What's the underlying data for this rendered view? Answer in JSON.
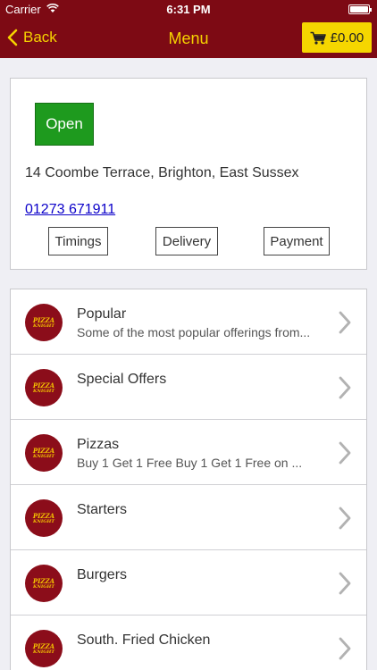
{
  "status_bar": {
    "carrier": "Carrier",
    "time": "6:31 PM"
  },
  "nav": {
    "back_label": "Back",
    "title": "Menu",
    "cart_total": "£0.00"
  },
  "store": {
    "status": "Open",
    "address": "14 Coombe Terrace, Brighton, East Sussex",
    "phone": "01273 671911",
    "buttons": {
      "timings": "Timings",
      "delivery": "Delivery",
      "payment": "Payment"
    }
  },
  "logo_text": {
    "line1": "PIZZA",
    "line2": "KNIGHT"
  },
  "menu": [
    {
      "title": "Popular",
      "subtitle": "Some of the most popular offerings from..."
    },
    {
      "title": "Special Offers",
      "subtitle": ""
    },
    {
      "title": "Pizzas",
      "subtitle": " Buy 1 Get 1 Free  Buy 1 Get 1 Free on ..."
    },
    {
      "title": "Starters",
      "subtitle": ""
    },
    {
      "title": "Burgers",
      "subtitle": ""
    },
    {
      "title": "South. Fried Chicken",
      "subtitle": ""
    }
  ],
  "colors": {
    "brand": "#7d0a14",
    "accent": "#f5d200",
    "open": "#1e9a1e",
    "link": "#0b00c9"
  }
}
